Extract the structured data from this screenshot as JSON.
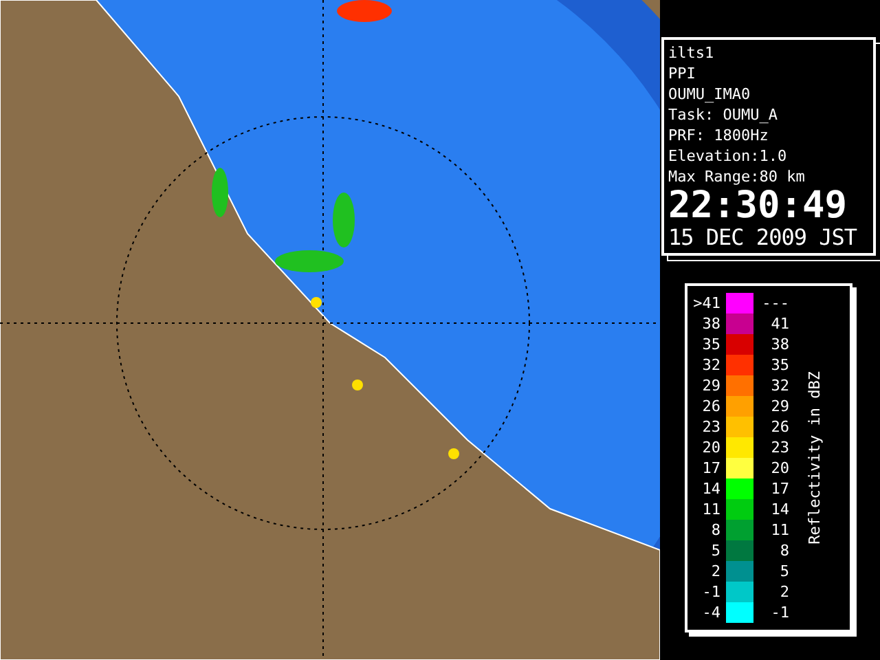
{
  "info": {
    "lines": [
      "ilts1",
      "PPI",
      "OUMU_IMA0",
      "Task: OUMU_A",
      "PRF: 1800Hz",
      "Elevation:1.0",
      "Max Range:80 km"
    ],
    "time": "22:30:49",
    "date": "15 DEC 2009 JST"
  },
  "legend": {
    "title": "Reflectivity in dBZ",
    "rows": [
      {
        "low": ">41",
        "high": "---",
        "color": "#ff00ff"
      },
      {
        "low": "38",
        "high": "41",
        "color": "#c80090"
      },
      {
        "low": "35",
        "high": "38",
        "color": "#d80000"
      },
      {
        "low": "32",
        "high": "35",
        "color": "#ff3000"
      },
      {
        "low": "29",
        "high": "32",
        "color": "#ff7000"
      },
      {
        "low": "26",
        "high": "29",
        "color": "#ffa000"
      },
      {
        "low": "23",
        "high": "26",
        "color": "#ffc000"
      },
      {
        "low": "20",
        "high": "23",
        "color": "#ffe800"
      },
      {
        "low": "17",
        "high": "20",
        "color": "#ffff40"
      },
      {
        "low": "14",
        "high": "17",
        "color": "#00ff00"
      },
      {
        "low": "11",
        "high": "14",
        "color": "#00cc10"
      },
      {
        "low": "8",
        "high": "11",
        "color": "#00a030"
      },
      {
        "low": "5",
        "high": "8",
        "color": "#007840"
      },
      {
        "low": "2",
        "high": "5",
        "color": "#009090"
      },
      {
        "low": "-1",
        "high": "2",
        "color": "#00c8c8"
      },
      {
        "low": "-4",
        "high": "-1",
        "color": "#00ffff"
      }
    ]
  }
}
